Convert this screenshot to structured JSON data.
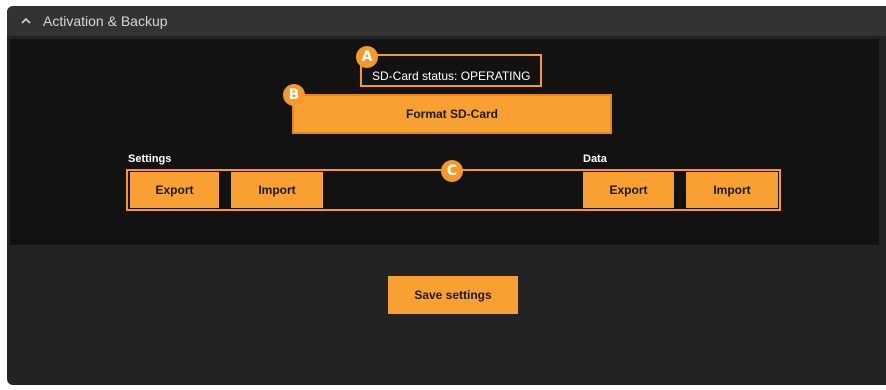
{
  "panel": {
    "title": "Activation & Backup"
  },
  "sd_card": {
    "status": "SD-Card status: OPERATING",
    "format_label": "Format SD-Card"
  },
  "settings_section": {
    "label": "Settings",
    "export_label": "Export",
    "import_label": "Import"
  },
  "data_section": {
    "label": "Data",
    "export_label": "Export",
    "import_label": "Import"
  },
  "save_label": "Save settings",
  "callouts": {
    "a": "A",
    "b": "B",
    "c": "C"
  },
  "colors": {
    "accent": "#f9a032",
    "panel_bg": "#232323",
    "header_bg": "#333333",
    "inner_bg": "#121212"
  },
  "icons": {
    "collapse": "chevron-up-icon"
  }
}
